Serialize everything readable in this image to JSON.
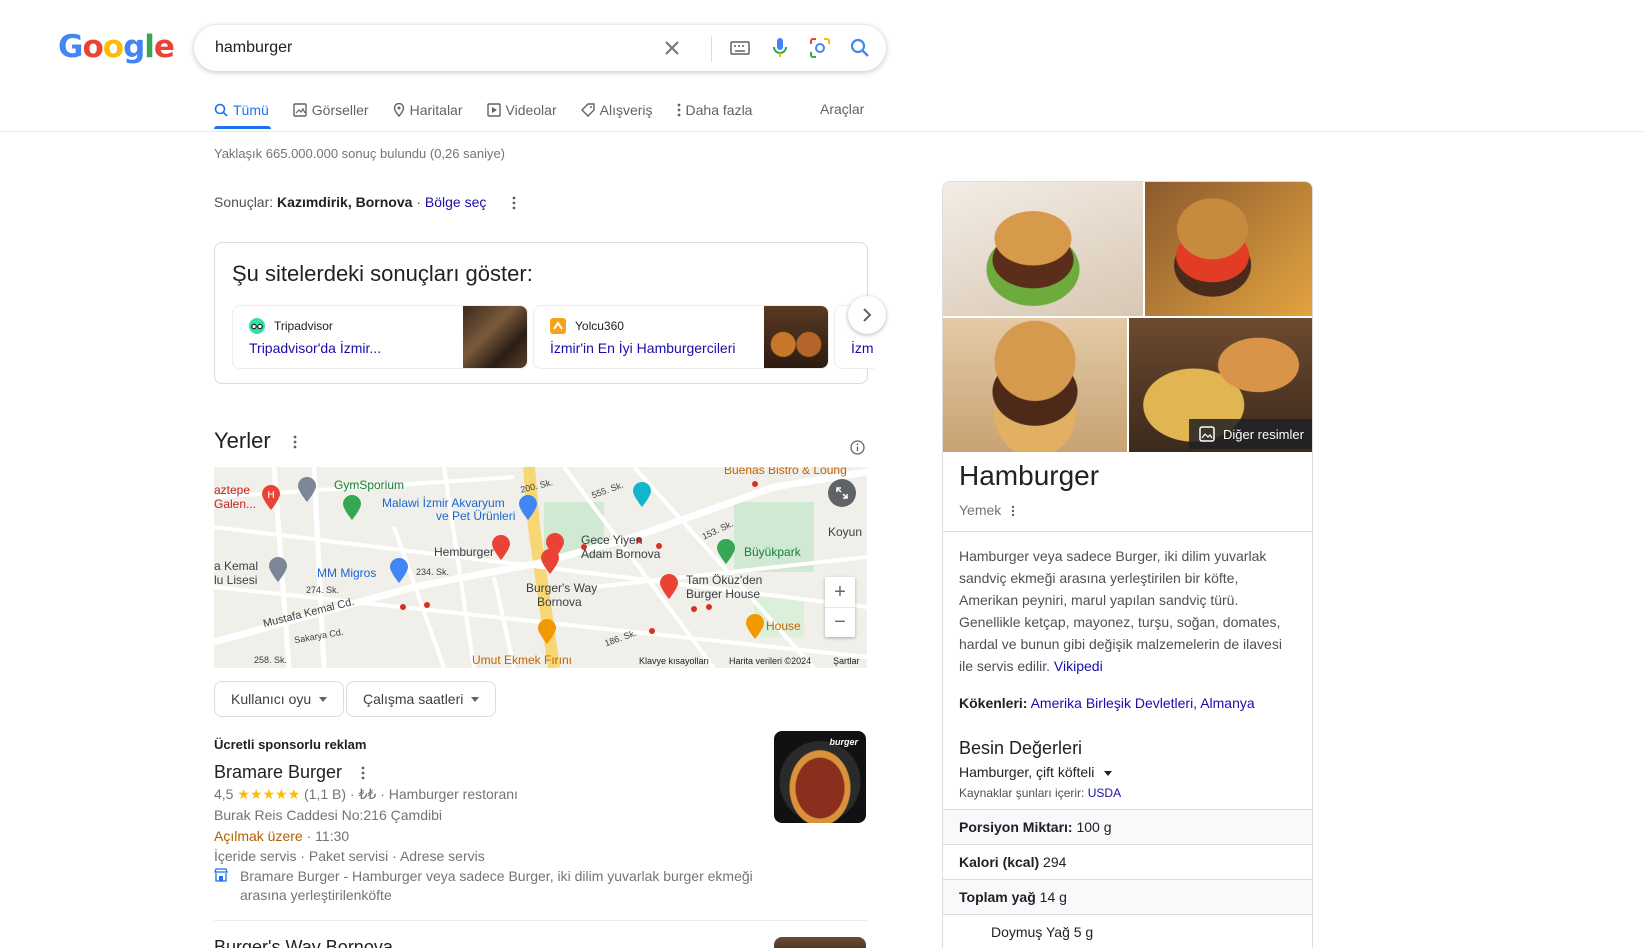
{
  "logo": {
    "letters": [
      "G",
      "o",
      "o",
      "g",
      "l",
      "e"
    ],
    "colors": [
      "#4285f4",
      "#ea4335",
      "#fbbc05",
      "#4285f4",
      "#34a853",
      "#ea4335"
    ]
  },
  "search": {
    "value": "hamburger"
  },
  "tabs": [
    {
      "label": "Tümü",
      "icon": "search-icon",
      "active": true
    },
    {
      "label": "Görseller",
      "icon": "image-icon"
    },
    {
      "label": "Haritalar",
      "icon": "map-pin-icon"
    },
    {
      "label": "Videolar",
      "icon": "video-icon"
    },
    {
      "label": "Alışveriş",
      "icon": "tag-icon"
    },
    {
      "label": "Daha fazla",
      "icon": "more-vert-icon"
    }
  ],
  "tools_label": "Araçlar",
  "stats": "Yaklaşık 665.000.000 sonuç bulundu (0,26 saniye)",
  "location": {
    "prefix": "Sonuçlar:",
    "place": "Kazımdirik, Bornova",
    "sep": "·",
    "link": "Bölge seç"
  },
  "sites": {
    "title": "Şu sitelerdeki sonuçları göster:",
    "items": [
      {
        "source": "Tripadvisor",
        "link": "Tripadvisor'da İzmir..."
      },
      {
        "source": "Yolcu360",
        "link": "İzmir'in En İyi Hamburgercileri"
      },
      {
        "source": "",
        "link": "İzm"
      }
    ]
  },
  "places": {
    "heading": "Yerler",
    "map_labels": [
      "aztepe",
      "Galen...",
      "GymSporium",
      "Malawi İzmir Akvaryum",
      "ve Pet Ürünleri",
      "Hemburger",
      "Gece Yiyen",
      "Adam Bornova",
      "Büyükpark",
      "Koyun",
      "a Kemal",
      "lu Lisesi",
      "MM Migros",
      "Burger's Way",
      "Bornova",
      "Tam Öküz'den",
      "Burger House",
      "Mustafa Kemal Cd.",
      "Umut Ekmek Fırını",
      "House",
      "200. Sk.",
      "555. Sk.",
      "153. Sk.",
      "234. Sk.",
      "274. Sk.",
      "Sakarya Cd.",
      "258. Sk.",
      "186. Sk.",
      "Buenas Bistro & Loung"
    ],
    "map_footer": [
      "Klavye kısayolları",
      "Harita verileri ©2024",
      "Şartlar"
    ],
    "filters": [
      "Kullanıcı oyu",
      "Çalışma saatleri"
    ]
  },
  "listing": {
    "sponsored": "Ücretli sponsorlu reklam",
    "name": "Bramare Burger",
    "rating": "4,5",
    "stars": "★★★★★",
    "reviews": "(1,1 B)",
    "price": "₺₺",
    "category": "Hamburger restoranı",
    "address": "Burak Reis Caddesi No:216 Çamdibi",
    "open_status": "Açılmak üzere",
    "open_time": "11:30",
    "services": "İçeride servis · Paket servisi · Adrese servis",
    "desc": "Bramare Burger - Hamburger veya sadece Burger, iki dilim yuvarlak burger ekmeği arasına yerleştirilenköfte",
    "thumb_text": "burger",
    "next_name": "Burger's Way Bornova"
  },
  "kp": {
    "more_images": "Diğer resimler",
    "title": "Hamburger",
    "subtitle": "Yemek",
    "desc": "Hamburger veya sadece Burger, iki dilim yuvarlak sandviç ekmeği arasına yerleştirilen bir köfte, Amerikan peyniri, marul yapılan sandviç türü. Genellikle ketçap, mayonez, turşu, soğan, domates, hardal ve bunun gibi değişik malzemelerin de ilavesi ile servis edilir.",
    "desc_link": "Vikipedi",
    "origin_label": "Kökenleri:",
    "origin_value": "Amerika Birleşik Devletleri, Almanya",
    "nutrition_heading": "Besin Değerleri",
    "nutrition_select": "Hamburger, çift köfteli",
    "source_prefix": "Kaynaklar şunları içerir:",
    "source_link": "USDA",
    "rows": [
      {
        "label": "Porsiyon Miktarı:",
        "value": "100 g"
      },
      {
        "label": "Kalori (kcal)",
        "value": "294"
      },
      {
        "label": "Toplam yağ",
        "value": "14 g"
      },
      {
        "label": "Doymuş Yağ",
        "value": "5 g"
      }
    ]
  }
}
